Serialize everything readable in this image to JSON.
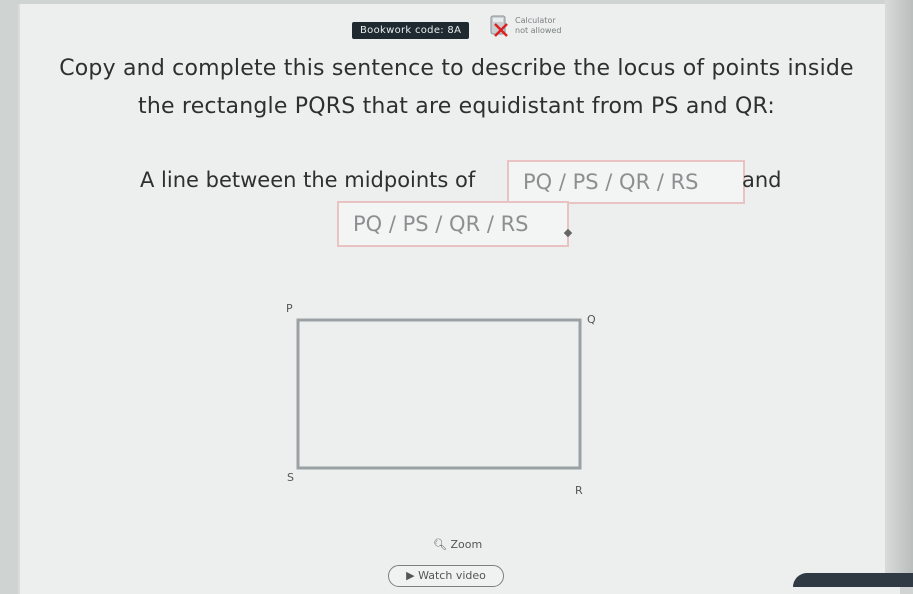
{
  "header": {
    "bookwork_label": "Bookwork code: 8A",
    "calculator_line1": "Calculator",
    "calculator_line2": "not allowed"
  },
  "question": {
    "line1": "Copy and complete this sentence to describe the locus of points inside",
    "line2": "the rectangle PQRS that are equidistant from PS and QR:"
  },
  "sentence": {
    "prefix": "A line between the midpoints of",
    "choice_1": "PQ / PS / QR / RS",
    "joiner": "and",
    "choice_2": "PQ / PS / QR / RS"
  },
  "diagram": {
    "labels": {
      "p": "P",
      "q": "Q",
      "s": "S",
      "r": "R"
    }
  },
  "footer": {
    "zoom_label": "Zoom",
    "watch_video_label": "Watch video"
  },
  "colors": {
    "choice_border": "#e9c3c3",
    "bookwork_bg": "#1e2a2f"
  }
}
